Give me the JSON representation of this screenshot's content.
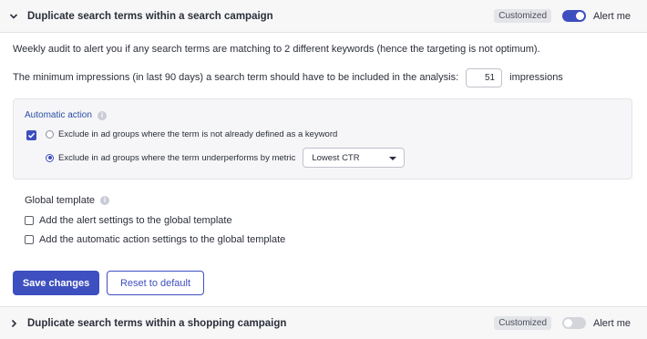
{
  "section_top": {
    "title": "Duplicate search terms within a search campaign",
    "badge": "Customized",
    "alert_label": "Alert me",
    "alert_enabled": true
  },
  "description": "Weekly audit to alert you if any search terms are matching to 2 different keywords (hence the targeting is not optimum).",
  "min_impressions": {
    "label": "The minimum impressions (in last 90 days) a search term should have to be included in the analysis:",
    "value": "51",
    "suffix": "impressions"
  },
  "automatic_action": {
    "title": "Automatic action",
    "enabled": true,
    "options": [
      {
        "label": "Exclude in ad groups where the term is not already defined as a keyword",
        "selected": false
      },
      {
        "label": "Exclude in ad groups where the term underperforms by metric",
        "selected": true
      }
    ],
    "metric_select": {
      "value": "Lowest CTR"
    }
  },
  "global_template": {
    "title": "Global template",
    "options": [
      {
        "label": "Add the alert settings to the global template",
        "checked": false
      },
      {
        "label": "Add the automatic action settings to the global template",
        "checked": false
      }
    ]
  },
  "buttons": {
    "save": "Save changes",
    "reset": "Reset to default"
  },
  "section_bottom": {
    "title": "Duplicate search terms within a shopping campaign",
    "badge": "Customized",
    "alert_label": "Alert me",
    "alert_enabled": false
  },
  "colors": {
    "accent": "#3e4fbf",
    "header_bg": "#f7f7f8",
    "panel_bg": "#f6f6f8"
  }
}
